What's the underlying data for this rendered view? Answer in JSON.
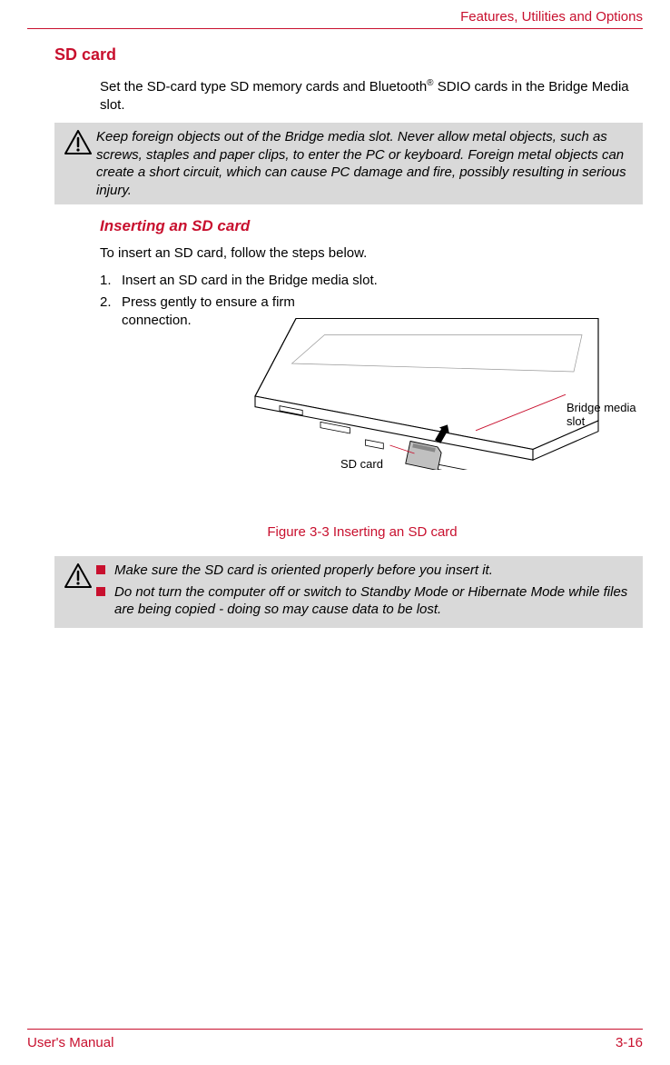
{
  "header": {
    "chapter_title": "Features, Utilities and Options"
  },
  "section": {
    "heading": "SD card",
    "intro_a": "Set the SD-card type SD memory cards and Bluetooth",
    "intro_sup": "®",
    "intro_b": " SDIO cards in the Bridge Media slot."
  },
  "warning1": {
    "text": "Keep foreign objects out of the Bridge media slot. Never allow metal objects, such as screws, staples and paper clips, to enter the PC or keyboard. Foreign metal objects can create a short circuit, which can cause PC damage and fire, possibly resulting in serious injury."
  },
  "subsection": {
    "heading": "Inserting an SD card",
    "intro": "To insert an SD card, follow the steps below.",
    "steps": [
      "Insert an SD card in the Bridge media slot.",
      "Press gently to ensure a firm connection."
    ]
  },
  "figure": {
    "callout_sd": "SD card",
    "callout_bridge": "Bridge media slot",
    "caption": "Figure 3-3 Inserting an SD card"
  },
  "warning2": {
    "items": [
      "Make sure the SD card is oriented properly before you insert it.",
      "Do not turn the computer off or switch to Standby Mode or Hibernate Mode while files are being copied - doing so may cause data to be lost."
    ]
  },
  "footer": {
    "left": "User's Manual",
    "right": "3-16"
  }
}
